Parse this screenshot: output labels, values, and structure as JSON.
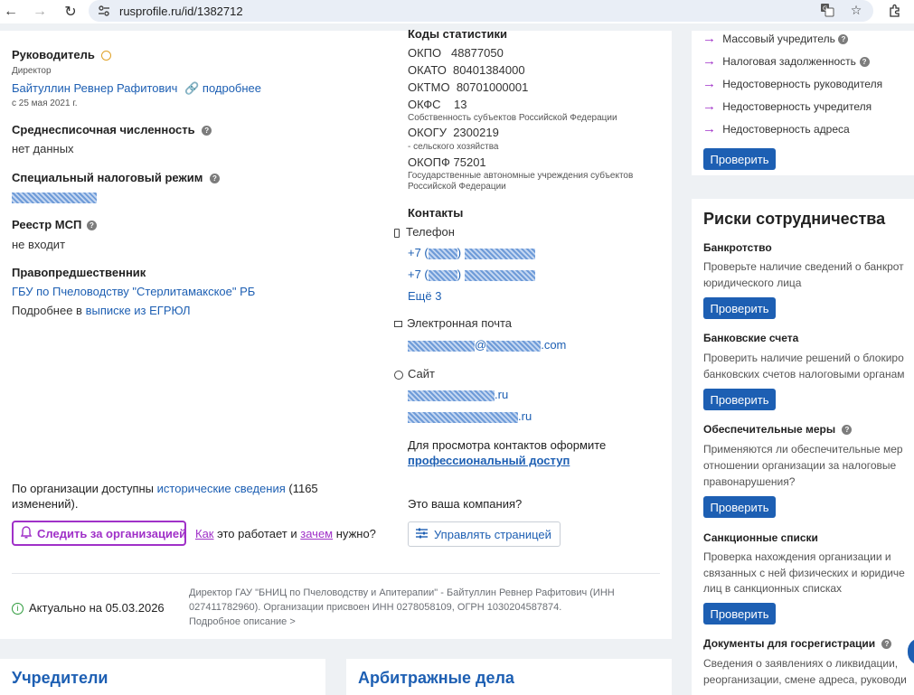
{
  "browser": {
    "url": "rusprofile.ru/id/1382712"
  },
  "leader": {
    "heading": "Руководитель",
    "role": "Директор",
    "name": "Байтуллин Ревнер Рафитович",
    "more_link": "подробнее",
    "since": "с 25 мая 2021 г."
  },
  "headcount": {
    "heading": "Среднесписочная численность",
    "value": "нет данных"
  },
  "tax_regime": {
    "heading": "Специальный налоговый режим"
  },
  "msp": {
    "heading": "Реестр МСП",
    "value": "не входит"
  },
  "predecessor": {
    "heading": "Правопредшественник",
    "name": "ГБУ по Пчеловодству \"Стерлитамакское\" РБ",
    "more_prefix": "Подробнее в",
    "more_link": "выписке из ЕГРЮЛ"
  },
  "history": {
    "prefix": "По организации доступны",
    "link": "исторические сведения",
    "suffix_line1": "(1165",
    "suffix_line2": "изменений)."
  },
  "follow": {
    "button": "Следить за организацией",
    "how_link": "Как",
    "middle": "это работает и",
    "why_link": "зачем",
    "end": "нужно?"
  },
  "stats": {
    "heading": "Коды статистики",
    "codes": [
      {
        "label": "ОКПО",
        "value": "48877050"
      },
      {
        "label": "ОКАТО",
        "value": "80401384000"
      },
      {
        "label": "ОКТМО",
        "value": "80701000001"
      },
      {
        "label": "ОКФС",
        "value": "13"
      }
    ],
    "okfs_note": "Собственность субъектов Российской Федерации",
    "okogu": {
      "label": "ОКОГУ",
      "value": "2300219"
    },
    "okogu_note": "- сельского хозяйства",
    "okopf": {
      "label": "ОКОПФ",
      "value": "75201"
    },
    "okopf_note_line1": "Государственные автономные учреждения субъектов",
    "okopf_note_line2": "Российской Федерации"
  },
  "contacts": {
    "heading": "Контакты",
    "phone_label": "Телефон",
    "phone_prefix": "+7 (",
    "phone_close": ")",
    "more_phones": "Ещё 3",
    "email_label": "Электронная почта",
    "email_at": "@",
    "email_tld": ".com",
    "site_label": "Сайт",
    "site1_tld": ".ru",
    "site2_tld": ".ru",
    "access_text": "Для просмотра контактов оформите",
    "access_link": "профессиональный доступ",
    "your_company": "Это ваша компания?",
    "manage_button": "Управлять страницей"
  },
  "footer": {
    "actual": "Актуально на 05.03.2026",
    "desc_line1": "Директор ГАУ \"БНИЦ по Пчеловодству и Апитерапии\" - Байтуллин Ревнер Рафитович (ИНН",
    "desc_line2": "027411782960). Организации присвоен ИНН 0278058109, ОГРН 1030204587874.",
    "desc_line3": "Подробное описание >"
  },
  "checks": {
    "items": [
      "Массовый учредитель",
      "Налоговая задолженность",
      "Недостоверность руководителя",
      "Недостоверность учредителя",
      "Недостоверность адреса"
    ],
    "button": "Проверить"
  },
  "risks": {
    "heading": "Риски сотрудничества",
    "sections": [
      {
        "title": "Банкротство",
        "text_line1": "Проверьте наличие сведений о банкрот",
        "text_line2": "юридического лица",
        "text_line3": "",
        "button": "Проверить"
      },
      {
        "title": "Банковские счета",
        "text_line1": "Проверить наличие решений о блокиро",
        "text_line2": "банковских счетов налоговыми органам",
        "text_line3": "",
        "button": "Проверить"
      },
      {
        "title": "Обеспечительные меры",
        "text_line1": "Применяются ли обеспечительные мер",
        "text_line2": "отношении организации за налоговые",
        "text_line3": "правонарушения?",
        "button": "Проверить"
      },
      {
        "title": "Санкционные списки",
        "text_line1": "Проверка нахождения организации и",
        "text_line2": "связанных с ней физических и юридиче",
        "text_line3": "лиц в санкционных списках",
        "button": "Проверить"
      },
      {
        "title": "Документы для госрегистрации",
        "text_line1": "Сведения о заявлениях о ликвидации,",
        "text_line2": "реорганизации, смене адреса, руководи",
        "text_line3": "",
        "button": ""
      }
    ]
  },
  "bottom": {
    "founders": "Учредители",
    "arbitration": "Арбитражные дела"
  }
}
